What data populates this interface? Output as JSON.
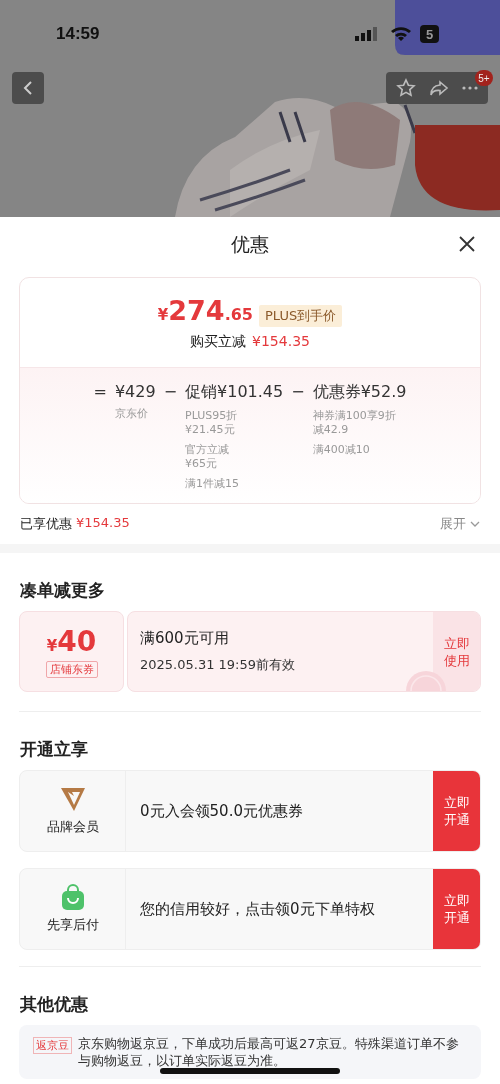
{
  "status_bar": {
    "time": "14:59",
    "battery": "5"
  },
  "nav": {
    "badge": "5+"
  },
  "sheet": {
    "title": "优惠"
  },
  "price_card": {
    "currency": "¥",
    "price_integer": "274",
    "price_decimal": ".65",
    "price_tag": "PLUS到手价",
    "reduce_label": "购买立减",
    "reduce_value": "¥154.35",
    "terms": [
      {
        "op": "=",
        "value": "¥429",
        "details": [
          "京东价"
        ]
      },
      {
        "op": "−",
        "name": "促销",
        "value": "¥101.45",
        "details": [
          "PLUS95折¥21.45元",
          "官方立减¥65元",
          "满1件减15"
        ]
      },
      {
        "op": "−",
        "name": "优惠券",
        "value": "¥52.9",
        "details": [
          "神券满100享9折减42.9",
          "满400减10"
        ]
      }
    ]
  },
  "enjoyed": {
    "label": "已享优惠",
    "value": "¥154.35",
    "toggle": "展开"
  },
  "sections": [
    {
      "title": "凑单减更多",
      "kind": "coupon",
      "coupon": {
        "currency": "¥",
        "amount": "40",
        "tag": "店铺东券",
        "condition": "满600元可用",
        "validity": "2025.05.31 19:59前有效",
        "action": "立即使用"
      }
    },
    {
      "title": "开通立享",
      "kind": "offers",
      "offers": [
        {
          "kind": "membership",
          "label": "品牌会员",
          "text": "0元入会领50.0元优惠券",
          "action": "立即开通"
        },
        {
          "kind": "pay_later",
          "label": "先享后付",
          "text": "您的信用较好，点击领0元下单特权",
          "action": "立即开通"
        }
      ]
    },
    {
      "title": "其他优惠",
      "kind": "info",
      "info": {
        "tag": "返京豆",
        "text": "京东购物返京豆，下单成功后最高可返27京豆。特殊渠道订单不参与购物返豆，以订单实际返豆为准。"
      }
    }
  ]
}
